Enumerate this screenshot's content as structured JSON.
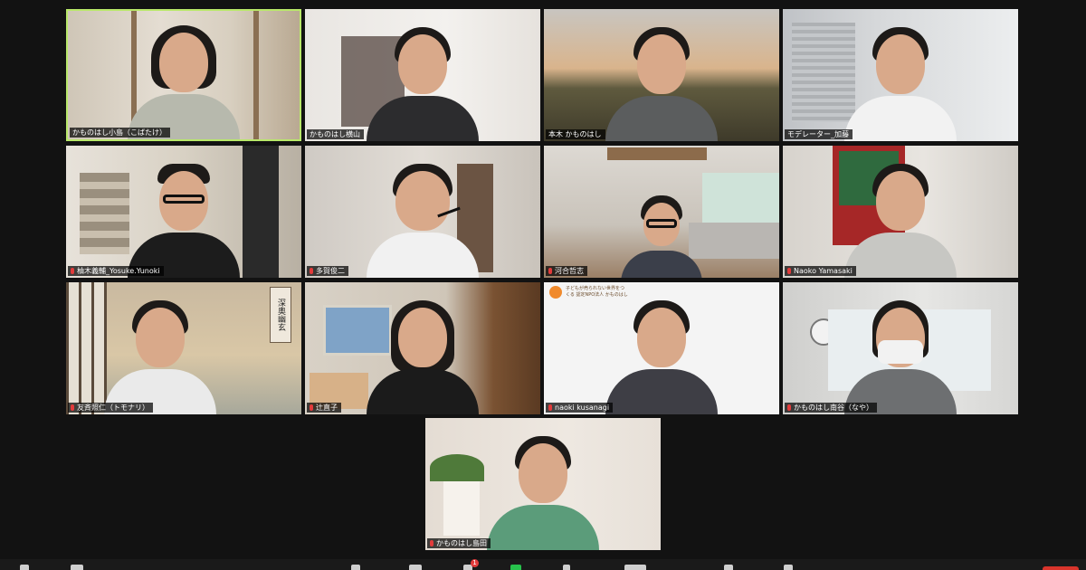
{
  "participants": [
    {
      "name": "かものはし小島（こばたけ）",
      "active": true
    },
    {
      "name": "かものはし横山"
    },
    {
      "name": "本木 かものはし"
    },
    {
      "name": "モデレーター_加藤"
    },
    {
      "name": "柚木義輔_Yosuke.Yunoki"
    },
    {
      "name": "多賀俊二"
    },
    {
      "name": "河合哲志"
    },
    {
      "name": "Naoko Yamasaki"
    },
    {
      "name": "友斉照仁（トモナリ）"
    },
    {
      "name": "辻直子"
    },
    {
      "name": "naoki kusanagi"
    },
    {
      "name": "かものはし南谷（なや）"
    },
    {
      "name": "かものはし島田"
    }
  ],
  "backgrounds": {
    "calligraphy_text": "深奥幽玄",
    "org_logo_text": "子どもが売られない世界をつくる 認定NPO法人 かものはし"
  },
  "toolbar": {
    "chat_badge": "1"
  },
  "colors": {
    "active_speaker_border": "#b9e86a",
    "muted_mic": "#e23b3b",
    "end_button": "#d9342b"
  }
}
